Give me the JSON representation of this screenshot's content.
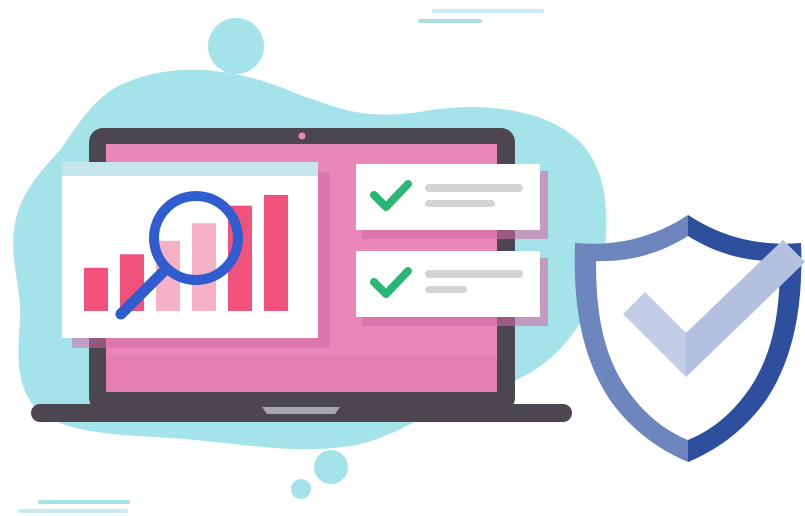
{
  "illustration": {
    "subject": "",
    "chart": {
      "bars": [
        0.32,
        0.42,
        0.52,
        0.65,
        0.78,
        0.86
      ],
      "highlighted_bars": [
        2,
        3
      ]
    },
    "checklist": {
      "items": [
        {
          "checked": true
        },
        {
          "checked": true
        }
      ]
    },
    "colors": {
      "blob": "#a5e3ea",
      "laptop_frame": "#4b4650",
      "screen": "#e887b8",
      "bar": "#f0527c",
      "bar_highlight": "#f7b1c6",
      "magnifier": "#2f5ccf",
      "check": "#2bb673",
      "shield_outer": "#6d86bd",
      "shield_dark": "#2d4f9e",
      "shield_inner": "#ffffff",
      "shield_check": "#c3cde6"
    },
    "icons": [
      "laptop-icon",
      "bar-chart-icon",
      "magnifier-icon",
      "checkmark-icon",
      "shield-check-icon"
    ]
  }
}
